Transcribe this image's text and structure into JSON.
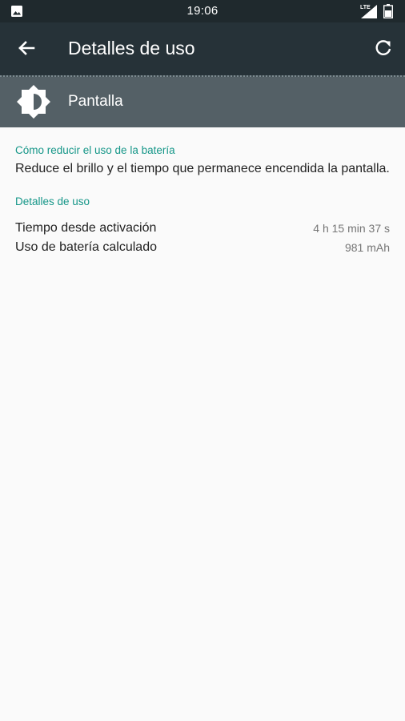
{
  "status_bar": {
    "time": "19:06",
    "network_type": "LTE",
    "icons": [
      "gallery-icon",
      "signal-icon",
      "battery-icon"
    ]
  },
  "app_bar": {
    "title": "Detalles de uso",
    "back_icon": "arrow-back-icon",
    "refresh_icon": "refresh-icon"
  },
  "header": {
    "app_name": "Pantalla",
    "icon": "brightness-icon"
  },
  "tips": {
    "heading": "Cómo reducir el uso de la batería",
    "text": "Reduce el brillo y el tiempo que permanece encendida la pantalla."
  },
  "usage": {
    "heading": "Detalles de uso",
    "rows": [
      {
        "label": "Tiempo desde activación",
        "value": "4 h 15 min 37 s"
      },
      {
        "label": "Uso de batería calculado",
        "value": "981 mAh"
      }
    ]
  },
  "colors": {
    "status_bar": "#1f292d",
    "app_bar": "#263238",
    "header_card": "#546066",
    "accent": "#159688",
    "background": "#fafafa"
  }
}
